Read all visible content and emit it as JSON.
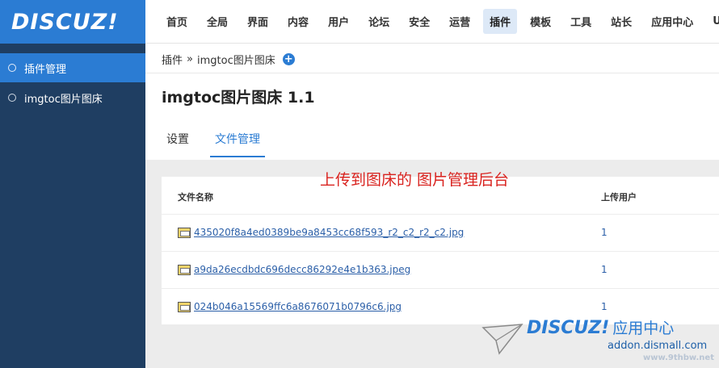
{
  "brand": {
    "logo_text": "DISCUZ!"
  },
  "topnav": {
    "items": [
      "首页",
      "全局",
      "界面",
      "内容",
      "用户",
      "论坛",
      "安全",
      "运营",
      "插件",
      "模板",
      "工具",
      "站长",
      "应用中心",
      "UCen"
    ],
    "active": "插件"
  },
  "sidebar": {
    "items": [
      {
        "label": "插件管理",
        "active": true
      },
      {
        "label": "imgtoc图片图床",
        "active": false
      }
    ]
  },
  "breadcrumb": {
    "parent": "插件",
    "separator": "»",
    "current": "imgtoc图片图床",
    "add_icon": "plus-icon"
  },
  "page": {
    "title": "imgtoc图片图床 1.1"
  },
  "tabs": [
    {
      "label": "设置",
      "active": false
    },
    {
      "label": "文件管理",
      "active": true
    }
  ],
  "table": {
    "columns": [
      "文件名称",
      "上传用户"
    ],
    "rows": [
      {
        "file": "435020f8a4ed0389be9a8453cc68f593_r2_c2_r2_c2.jpg",
        "user": "1"
      },
      {
        "file": "a9da26ecdbdc696decc86292e4e1b363.jpeg",
        "user": "1"
      },
      {
        "file": "024b046a15569ffc6a8676071b0796c6.jpg",
        "user": "1"
      }
    ]
  },
  "annotation": "上传到图床的 图片管理后台",
  "watermark": {
    "brand": "DISCUZ!",
    "brand_cn": "应用中心",
    "domain": "addon.dismall.com",
    "site": "www.9thbw.net"
  },
  "colors": {
    "accent": "#2b7cd3",
    "sidebar": "#1f3e62",
    "annotation": "#d9231f"
  }
}
